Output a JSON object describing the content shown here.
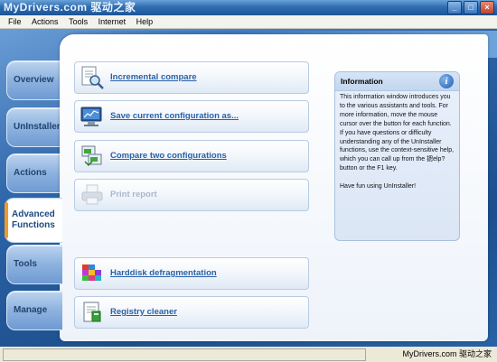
{
  "window": {
    "title": "MyDrivers.com 驱动之家",
    "controls": [
      "_",
      "□",
      "×"
    ]
  },
  "menu": [
    "File",
    "Actions",
    "Tools",
    "Internet",
    "Help"
  ],
  "tabs": [
    {
      "label": "Overview",
      "active": false
    },
    {
      "label": "UnInstaller",
      "active": false
    },
    {
      "label": "Actions",
      "active": false
    },
    {
      "label": "Advanced\nFunctions",
      "active": true
    },
    {
      "label": "Tools",
      "active": false
    },
    {
      "label": "Manage",
      "active": false
    }
  ],
  "functions": [
    {
      "label": "Incremental compare",
      "icon": "compare-document-icon",
      "enabled": true
    },
    {
      "label": "Save current configuration as...",
      "icon": "monitor-save-icon",
      "enabled": true
    },
    {
      "label": "Compare two configurations",
      "icon": "compare-configurations-icon",
      "enabled": true
    },
    {
      "label": "Print report",
      "icon": "printer-icon",
      "enabled": false
    },
    {
      "label": "Harddisk defragmentation",
      "icon": "defrag-blocks-icon",
      "enabled": true
    },
    {
      "label": "Registry cleaner",
      "icon": "registry-cleaner-icon",
      "enabled": true
    }
  ],
  "info": {
    "title": "Information",
    "text": "This information window introduces you to the various assistants and tools. For more information, move the mouse cursor over the button for each function. If you have questions or difficulty understanding any of the UnInstaller functions, use the context-sensitive help, which you can call up from the 揌elp?button or the F1 key.\n\nHave fun using UnInstaller!"
  },
  "watermark": "MyDrivers.com 驱动之家",
  "colors": {
    "accent": "#2a61a6",
    "active_tab_marker": "#f09a2a",
    "background": "#1f5fa0"
  }
}
